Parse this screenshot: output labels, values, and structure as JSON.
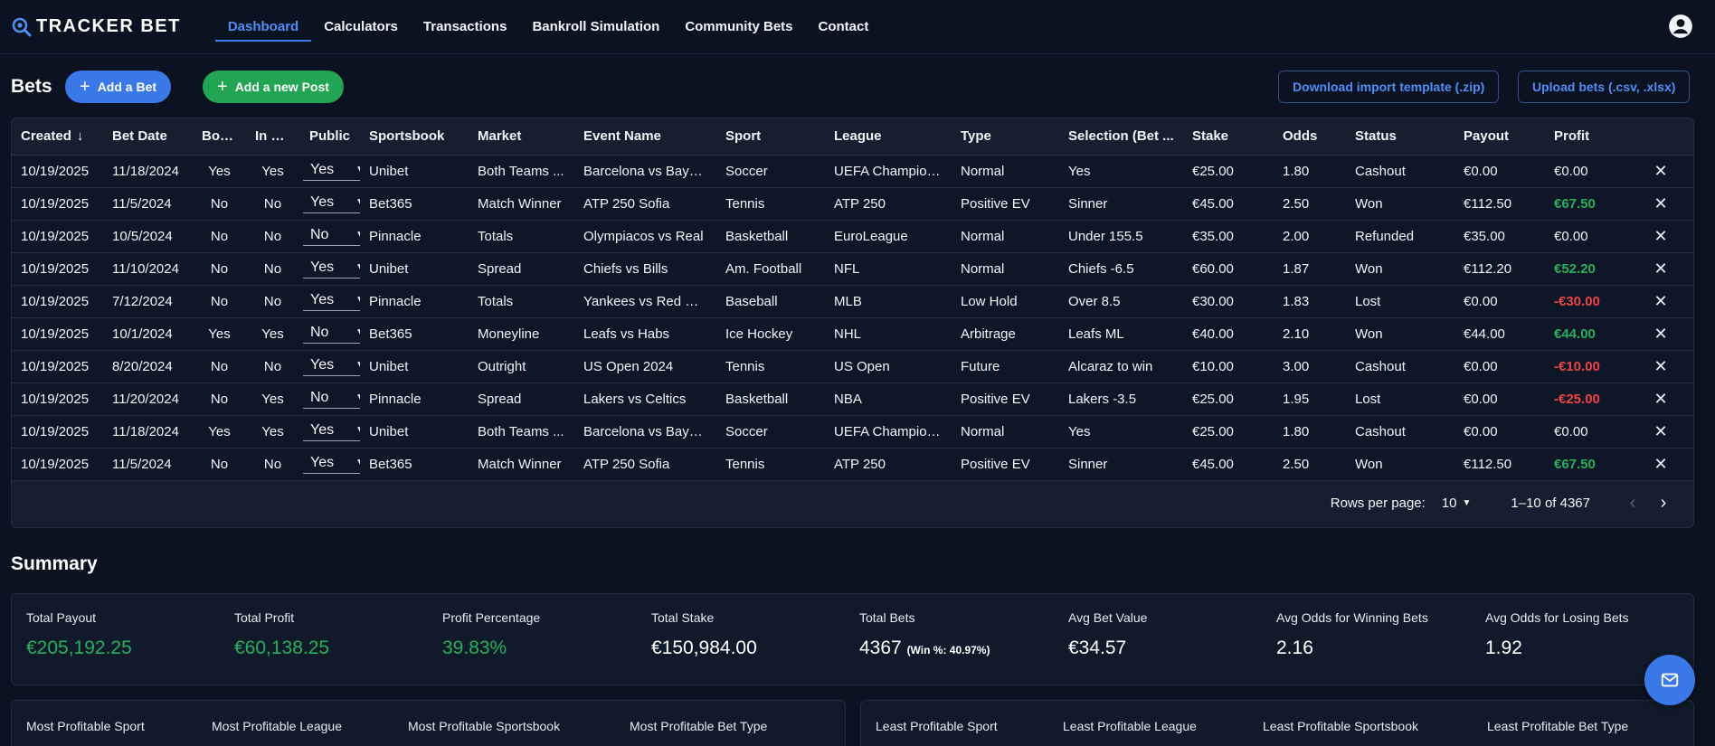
{
  "brand": {
    "name": "TRACKER BET"
  },
  "nav": {
    "links": [
      {
        "label": "Dashboard",
        "active": true
      },
      {
        "label": "Calculators"
      },
      {
        "label": "Transactions"
      },
      {
        "label": "Bankroll Simulation"
      },
      {
        "label": "Community Bets"
      },
      {
        "label": "Contact"
      }
    ]
  },
  "bets": {
    "title": "Bets",
    "add_bet": "Add a Bet",
    "add_post": "Add a new Post",
    "download_template": "Download import template (.zip)",
    "upload": "Upload bets (.csv, .xlsx)",
    "columns": [
      "Created",
      "Bet Date",
      "Bonus",
      "In Pl...",
      "Public",
      "Sportsbook",
      "Market",
      "Event Name",
      "Sport",
      "League",
      "Type",
      "Selection (Bet ...",
      "Stake",
      "Odds",
      "Status",
      "Payout",
      "Profit"
    ],
    "rows": [
      [
        "10/19/2025",
        "11/18/2024",
        "Yes",
        "Yes",
        "Yes",
        "Unibet",
        "Both Teams ...",
        "Barcelona vs Bayern",
        "Soccer",
        "UEFA Champion...",
        "Normal",
        "Yes",
        "€25.00",
        "1.80",
        "Cashout",
        "€0.00",
        "€0.00"
      ],
      [
        "10/19/2025",
        "11/5/2024",
        "No",
        "No",
        "Yes",
        "Bet365",
        "Match Winner",
        "ATP 250 Sofia",
        "Tennis",
        "ATP 250",
        "Positive EV",
        "Sinner",
        "€45.00",
        "2.50",
        "Won",
        "€112.50",
        "€67.50"
      ],
      [
        "10/19/2025",
        "10/5/2024",
        "No",
        "No",
        "No",
        "Pinnacle",
        "Totals",
        "Olympiacos vs Real",
        "Basketball",
        "EuroLeague",
        "Normal",
        "Under 155.5",
        "€35.00",
        "2.00",
        "Refunded",
        "€35.00",
        "€0.00"
      ],
      [
        "10/19/2025",
        "11/10/2024",
        "No",
        "No",
        "Yes",
        "Unibet",
        "Spread",
        "Chiefs vs Bills",
        "Am. Football",
        "NFL",
        "Normal",
        "Chiefs -6.5",
        "€60.00",
        "1.87",
        "Won",
        "€112.20",
        "€52.20"
      ],
      [
        "10/19/2025",
        "7/12/2024",
        "No",
        "No",
        "Yes",
        "Pinnacle",
        "Totals",
        "Yankees vs Red Sox",
        "Baseball",
        "MLB",
        "Low Hold",
        "Over 8.5",
        "€30.00",
        "1.83",
        "Lost",
        "€0.00",
        "-€30.00"
      ],
      [
        "10/19/2025",
        "10/1/2024",
        "Yes",
        "Yes",
        "No",
        "Bet365",
        "Moneyline",
        "Leafs vs Habs",
        "Ice Hockey",
        "NHL",
        "Arbitrage",
        "Leafs ML",
        "€40.00",
        "2.10",
        "Won",
        "€44.00",
        "€44.00"
      ],
      [
        "10/19/2025",
        "8/20/2024",
        "No",
        "No",
        "Yes",
        "Unibet",
        "Outright",
        "US Open 2024",
        "Tennis",
        "US Open",
        "Future",
        "Alcaraz to win",
        "€10.00",
        "3.00",
        "Cashout",
        "€0.00",
        "-€10.00"
      ],
      [
        "10/19/2025",
        "11/20/2024",
        "No",
        "Yes",
        "No",
        "Pinnacle",
        "Spread",
        "Lakers vs Celtics",
        "Basketball",
        "NBA",
        "Positive EV",
        "Lakers -3.5",
        "€25.00",
        "1.95",
        "Lost",
        "€0.00",
        "-€25.00"
      ],
      [
        "10/19/2025",
        "11/18/2024",
        "Yes",
        "Yes",
        "Yes",
        "Unibet",
        "Both Teams ...",
        "Barcelona vs Bayern",
        "Soccer",
        "UEFA Champion...",
        "Normal",
        "Yes",
        "€25.00",
        "1.80",
        "Cashout",
        "€0.00",
        "€0.00"
      ],
      [
        "10/19/2025",
        "11/5/2024",
        "No",
        "No",
        "Yes",
        "Bet365",
        "Match Winner",
        "ATP 250 Sofia",
        "Tennis",
        "ATP 250",
        "Positive EV",
        "Sinner",
        "€45.00",
        "2.50",
        "Won",
        "€112.50",
        "€67.50"
      ]
    ],
    "pagination": {
      "rows_per_page_label": "Rows per page:",
      "rows_per_page": "10",
      "range": "1–10 of 4367"
    }
  },
  "summary": {
    "title": "Summary",
    "stats": [
      {
        "label": "Total Payout",
        "value": "€205,192.25",
        "accent": true
      },
      {
        "label": "Total Profit",
        "value": "€60,138.25",
        "accent": true
      },
      {
        "label": "Profit Percentage",
        "value": "39.83%",
        "accent": true
      },
      {
        "label": "Total Stake",
        "value": "€150,984.00"
      },
      {
        "label": "Total Bets",
        "value": "4367",
        "note": "(Win %: 40.97%)"
      },
      {
        "label": "Avg Bet Value",
        "value": "€34.57"
      },
      {
        "label": "Avg Odds for Winning Bets",
        "value": "2.16"
      },
      {
        "label": "Avg Odds for Losing Bets",
        "value": "1.92"
      }
    ],
    "most": [
      "Most Profitable Sport",
      "Most Profitable League",
      "Most Profitable Sportsbook",
      "Most Profitable Bet Type"
    ],
    "least": [
      "Least Profitable Sport",
      "Least Profitable League",
      "Least Profitable Sportsbook",
      "Least Profitable Bet Type"
    ]
  },
  "colors": {
    "accent": "#3a78e7",
    "green": "#25b15c",
    "red": "#ef4444",
    "bg": "#0b1221"
  },
  "icons": {
    "logo": "magnifier-logo-icon",
    "avatar": "account-circle-icon",
    "fab": "mail-icon",
    "delete": "close-icon"
  }
}
